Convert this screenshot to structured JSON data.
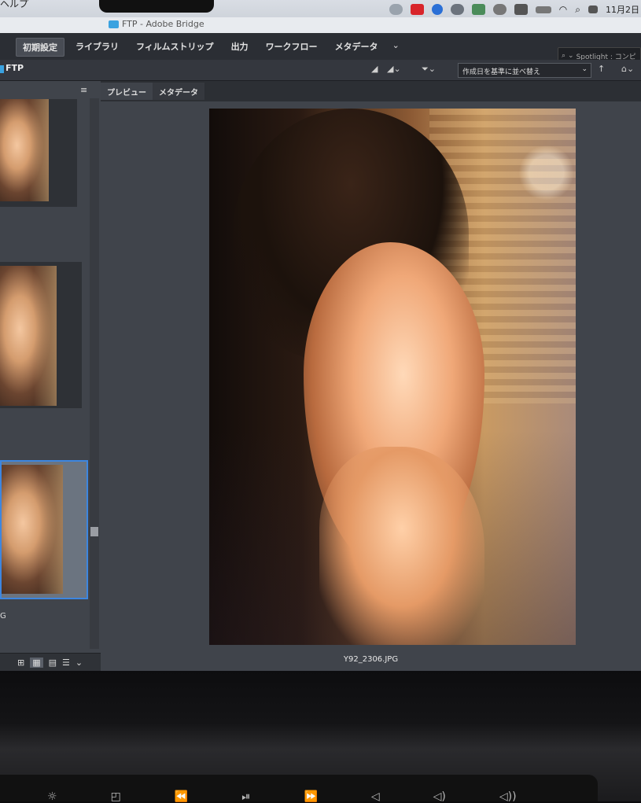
{
  "menubar": {
    "app_name": "ヘルプ",
    "date": "11月2日",
    "status_icons": [
      "cloud-icon",
      "app-red-icon",
      "butterfly-icon",
      "sync-icon",
      "app-icon",
      "chat-icon",
      "ime-icon",
      "battery-icon",
      "wifi-icon",
      "search-icon",
      "control-center-icon"
    ]
  },
  "window": {
    "title": "FTP - Adobe Bridge"
  },
  "workspace": {
    "tabs": [
      "初期設定",
      "ライブラリ",
      "フィルムストリップ",
      "出力",
      "ワークフロー",
      "メタデータ"
    ],
    "active_index": 0,
    "search_placeholder": "Spotlight : コンピ"
  },
  "pathbar": {
    "folder": "FTP",
    "sort_label": "作成日を基準に並べ替え"
  },
  "preview_panel": {
    "tabs": [
      "プレビュー",
      "メタデータ"
    ],
    "filename": "Y92_2306.JPG"
  },
  "filmstrip": {
    "partial_label": "G"
  },
  "colors": {
    "accent": "#3d86e0",
    "panel": "#40444b",
    "folder": "#3aa2e0"
  }
}
